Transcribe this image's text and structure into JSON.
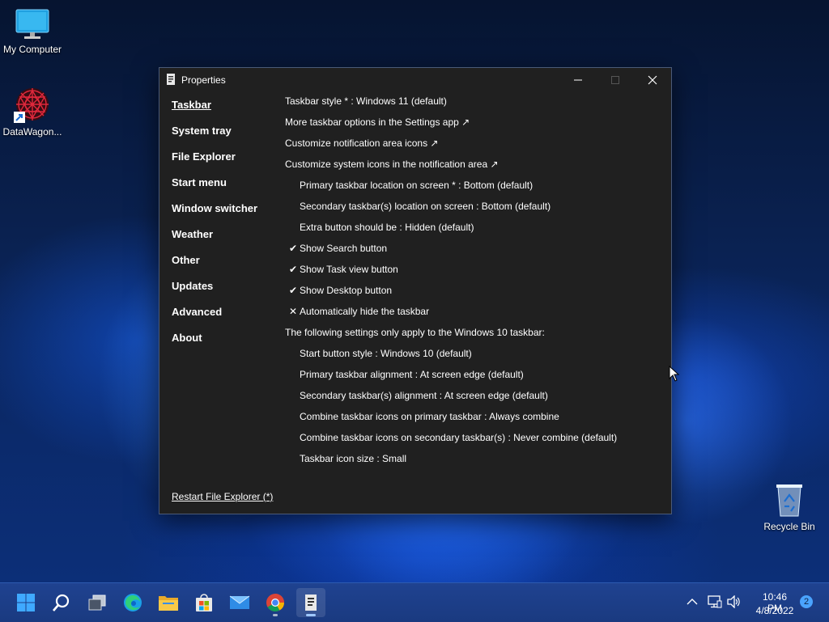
{
  "desktop": {
    "icons": [
      {
        "label": "My Computer"
      },
      {
        "label": "DataWagon..."
      },
      {
        "label": "Recycle Bin"
      }
    ]
  },
  "window": {
    "title": "Properties",
    "nav": [
      {
        "label": "Taskbar",
        "active": true
      },
      {
        "label": "System tray"
      },
      {
        "label": "File Explorer"
      },
      {
        "label": "Start menu"
      },
      {
        "label": "Window switcher"
      },
      {
        "label": "Weather"
      },
      {
        "label": "Other"
      },
      {
        "label": "Updates"
      },
      {
        "label": "Advanced"
      },
      {
        "label": "About"
      }
    ],
    "settings": [
      {
        "text": "Taskbar style * : Windows 11 (default)",
        "indent": false,
        "mark": ""
      },
      {
        "text": "More taskbar options in the Settings app ↗",
        "indent": false,
        "mark": ""
      },
      {
        "text": "Customize notification area icons ↗",
        "indent": false,
        "mark": ""
      },
      {
        "text": "Customize system icons in the notification area ↗",
        "indent": false,
        "mark": ""
      },
      {
        "text": "Primary taskbar location on screen * : Bottom (default)",
        "indent": true,
        "mark": ""
      },
      {
        "text": "Secondary taskbar(s) location on screen : Bottom (default)",
        "indent": true,
        "mark": ""
      },
      {
        "text": "Extra button should be : Hidden (default)",
        "indent": true,
        "mark": ""
      },
      {
        "text": "Show Search button",
        "indent": true,
        "mark": "✔"
      },
      {
        "text": "Show Task view button",
        "indent": true,
        "mark": "✔"
      },
      {
        "text": "Show Desktop button",
        "indent": true,
        "mark": "✔"
      },
      {
        "text": "Automatically hide the taskbar",
        "indent": true,
        "mark": "✕"
      },
      {
        "text": "The following settings only apply to the Windows 10 taskbar:",
        "indent": false,
        "mark": ""
      },
      {
        "text": "Start button style : Windows 10 (default)",
        "indent": true,
        "mark": ""
      },
      {
        "text": "Primary taskbar alignment : At screen edge (default)",
        "indent": true,
        "mark": ""
      },
      {
        "text": "Secondary taskbar(s) alignment : At screen edge (default)",
        "indent": true,
        "mark": ""
      },
      {
        "text": "Combine taskbar icons on primary taskbar : Always combine",
        "indent": true,
        "mark": ""
      },
      {
        "text": "Combine taskbar icons on secondary taskbar(s) : Never combine (default)",
        "indent": true,
        "mark": ""
      },
      {
        "text": "Taskbar icon size : Small",
        "indent": true,
        "mark": ""
      }
    ],
    "restart_link": "Restart File Explorer (*)"
  },
  "taskbar": {
    "apps": [
      {
        "name": "start-icon"
      },
      {
        "name": "search-icon"
      },
      {
        "name": "task-view-icon"
      },
      {
        "name": "edge-icon"
      },
      {
        "name": "file-explorer-icon"
      },
      {
        "name": "store-icon"
      },
      {
        "name": "mail-icon"
      },
      {
        "name": "chrome-icon"
      },
      {
        "name": "properties-app-icon"
      }
    ],
    "clock_time": "10:46 PM",
    "clock_date": "4/8/2022",
    "notification_count": "2"
  },
  "colors": {
    "window_bg": "#202020",
    "taskbar_bg": "#1a3a80",
    "accent": "#4aa3ff"
  }
}
